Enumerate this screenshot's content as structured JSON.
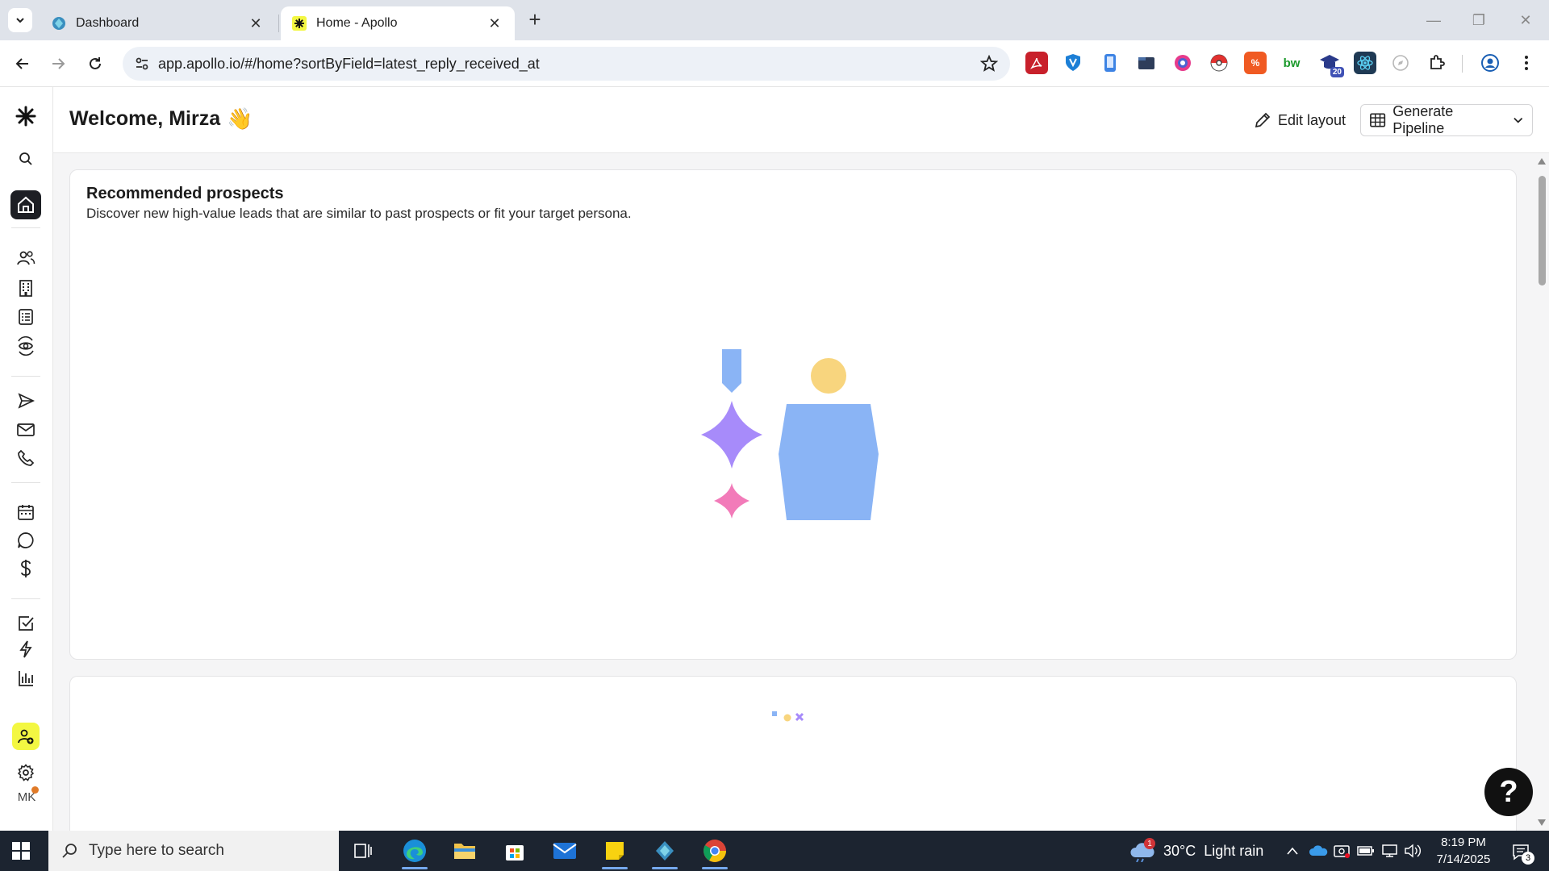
{
  "browser": {
    "tabs": [
      {
        "title": "Dashboard",
        "active": false
      },
      {
        "title": "Home - Apollo",
        "active": true
      }
    ],
    "url": "app.apollo.io/#/home?sortByField=latest_reply_received_at",
    "extension_badge": "20"
  },
  "header": {
    "welcome": "Welcome, Mirza",
    "wave_emoji": "👋",
    "edit_layout_label": "Edit layout",
    "generate_pipeline_label": "Generate Pipeline"
  },
  "recommended": {
    "title": "Recommended prospects",
    "subtitle": "Discover new high-value leads that are similar to past prospects or fit your target persona."
  },
  "sidebar": {
    "avatar_initials": "MK"
  },
  "help_label": "?",
  "taskbar": {
    "search_placeholder": "Type here to search",
    "weather": "30°C  Light rain",
    "weather_alert": "1",
    "time": "8:19 PM",
    "date": "7/14/2025",
    "notification_count": "3"
  },
  "colors": {
    "accent_yellow": "#f3f742",
    "sidebar_active": "#1d1f24",
    "illus_blue": "#8ab4f5",
    "illus_purple": "#a78bfa",
    "illus_pink": "#f27bb9",
    "illus_yellow": "#f8d57e"
  }
}
